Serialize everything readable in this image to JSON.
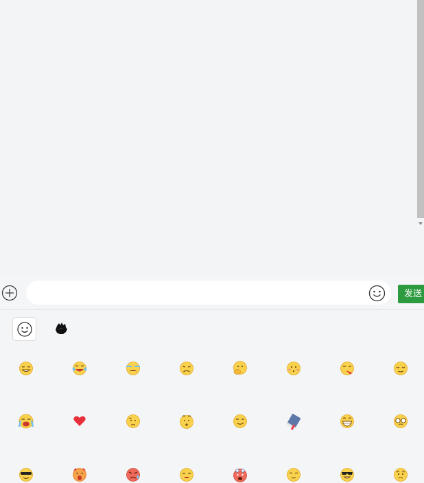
{
  "input": {
    "value": "",
    "placeholder": ""
  },
  "send_label": "发送",
  "icons": {
    "add": "plus-circle-icon",
    "emoji_toggle": "smiley-icon",
    "pack_default": "smiley-icon",
    "pack_custom": "sticker-icon"
  },
  "emoji_rows": [
    [
      "grin-wink-face",
      "laughing-tears-face",
      "dizzy-crying-face",
      "pouting-face",
      "thinking-hand-face",
      "blushing-face",
      "drooling-face",
      "relieved-face"
    ],
    [
      "crying-open-mouth-face",
      "red-heart",
      "wondering-face",
      "surprised-eyebrows-face",
      "smirking-face",
      "notebook",
      "grinning-teeth-face",
      "teary-glasses-face"
    ],
    [
      "sunglasses-face",
      "screaming-face",
      "angry-sweat-face",
      "unamused-face",
      "hit-head-face",
      "calm-face",
      "cool-sunglasses-face",
      "worried-face"
    ]
  ],
  "colors": {
    "send_button": "#2c9b3f",
    "background": "#f3f4f6",
    "emoji_yellow": "#f8d24d"
  }
}
